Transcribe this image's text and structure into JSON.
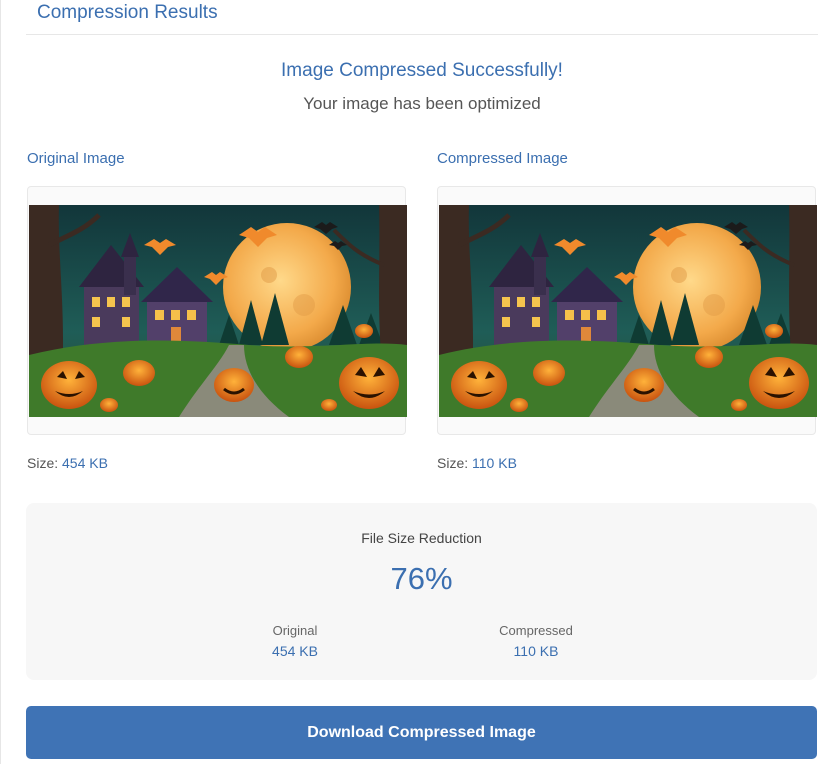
{
  "header": {
    "title": "Compression Results"
  },
  "status": {
    "title": "Image Compressed Successfully!",
    "subtitle": "Your image has been optimized"
  },
  "original": {
    "label": "Original Image",
    "size_label": "Size:",
    "size": "454 KB",
    "image_alt": "Halloween night scene with haunted houses, full moon, bats and jack-o'-lanterns"
  },
  "compressed": {
    "label": "Compressed Image",
    "size_label": "Size:",
    "size": "110 KB",
    "image_alt": "Halloween night scene with haunted houses, full moon, bats and jack-o'-lanterns"
  },
  "reduction": {
    "title": "File Size Reduction",
    "percent": "76%",
    "percent_value": 76,
    "original_label": "Original",
    "original_value": "454 KB",
    "compressed_label": "Compressed",
    "compressed_value": "110 KB"
  },
  "actions": {
    "download_label": "Download Compressed Image"
  },
  "colors": {
    "accent": "#3b6fb0",
    "button": "#3f73b5",
    "box_bg": "#f7f7f7"
  }
}
